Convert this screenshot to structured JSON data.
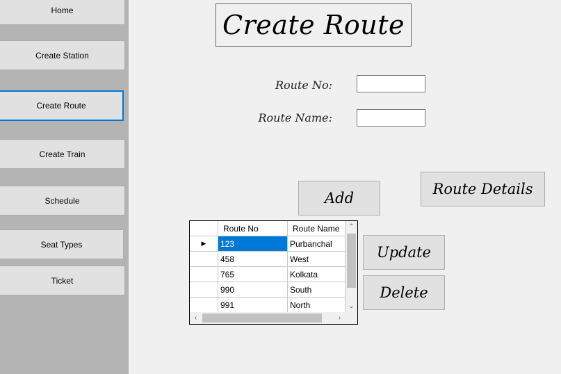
{
  "sidebar": {
    "items": [
      {
        "label": "Home"
      },
      {
        "label": "Create Station"
      },
      {
        "label": "Create Route"
      },
      {
        "label": "Create Train"
      },
      {
        "label": "Schedule"
      },
      {
        "label": "Seat Types"
      },
      {
        "label": "Ticket"
      }
    ]
  },
  "header": {
    "title": "Create Route"
  },
  "form": {
    "route_no_label": "Route No:",
    "route_no_value": "",
    "route_name_label": "Route Name:",
    "route_name_value": ""
  },
  "buttons": {
    "add": "Add",
    "route_details": "Route Details",
    "update": "Update",
    "delete": "Delete"
  },
  "grid": {
    "columns": [
      "Route No",
      "Route Name"
    ],
    "rows": [
      {
        "no": "123",
        "name": "Purbanchal",
        "selected": true
      },
      {
        "no": "458",
        "name": "West"
      },
      {
        "no": "765",
        "name": "Kolkata"
      },
      {
        "no": "990",
        "name": "South"
      },
      {
        "no": "991",
        "name": "North"
      }
    ]
  },
  "colors": {
    "selection": "#0078d7",
    "sidebar_bg": "#b4b4b4"
  }
}
